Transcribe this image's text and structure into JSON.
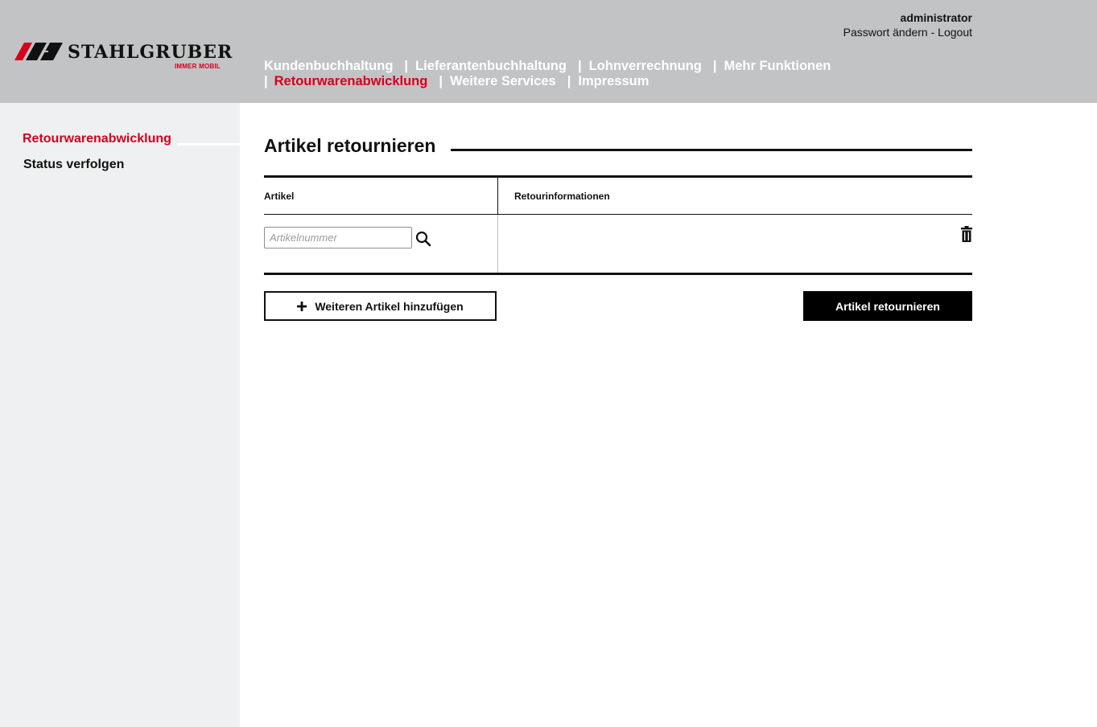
{
  "brand": {
    "name": "STAHLGRUBER",
    "tagline": "IMMER MOBIL",
    "accent_color": "#d4001c",
    "header_bg": "#c2c3c5",
    "sidebar_bg": "#eff0f1"
  },
  "user": {
    "name": "administrator",
    "change_password": "Passwort ändern",
    "separator": "-",
    "logout": "Logout"
  },
  "nav": {
    "row1": [
      {
        "label": "Kundenbuchhaltung",
        "active": false
      },
      {
        "label": "Lieferantenbuchhaltung",
        "active": false
      },
      {
        "label": "Lohnverrechnung",
        "active": false
      },
      {
        "label": "Mehr Funktionen",
        "active": false
      }
    ],
    "row2": [
      {
        "label": "Retourwarenabwicklung",
        "active": true
      },
      {
        "label": "Weitere Services",
        "active": false
      },
      {
        "label": "Impressum",
        "active": false
      }
    ],
    "separator": "|"
  },
  "sidebar": {
    "items": [
      {
        "label": "Retourwarenabwicklung",
        "active": true
      },
      {
        "label": "Status verfolgen",
        "active": false
      }
    ]
  },
  "main": {
    "title": "Artikel retournieren",
    "table": {
      "col_article": "Artikel",
      "col_return_info": "Retourinformationen",
      "article_input_value": "",
      "article_input_placeholder": "Artikelnummer",
      "search_icon": "search-icon",
      "delete_icon": "trash-icon"
    },
    "add_button": {
      "icon": "plus-icon",
      "label": "Weiteren Artikel hinzufügen"
    },
    "submit_button": {
      "label": "Artikel retournieren"
    }
  }
}
